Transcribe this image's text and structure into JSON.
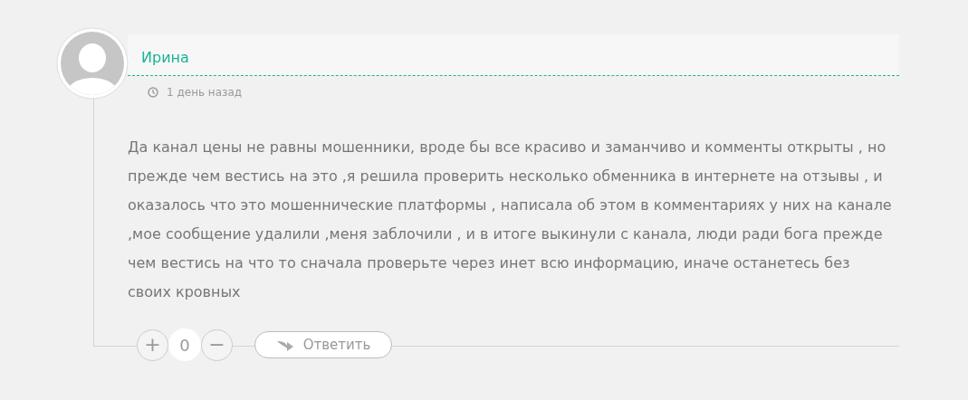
{
  "comment": {
    "author": "Ирина",
    "time": "1 день назад",
    "text": "Да канал цены не равны мошенники, вроде бы все красиво и заманчиво и комменты открыты , но прежде чем вестись на это ,я решила проверить несколько обменника в интернете на отзывы , и оказалось что это мошеннические платформы , написала об этом в комментариях у них на канале ,мое сообщение удалили ,меня заблочили , и в итоге выкинули с канала, люди ради бога прежде чем вестись на что то сначала проверьте через инет всю информацию, иначе останетесь без своих кровных",
    "plus": "+",
    "score": "0",
    "minus": "−",
    "reply": "Ответить"
  }
}
